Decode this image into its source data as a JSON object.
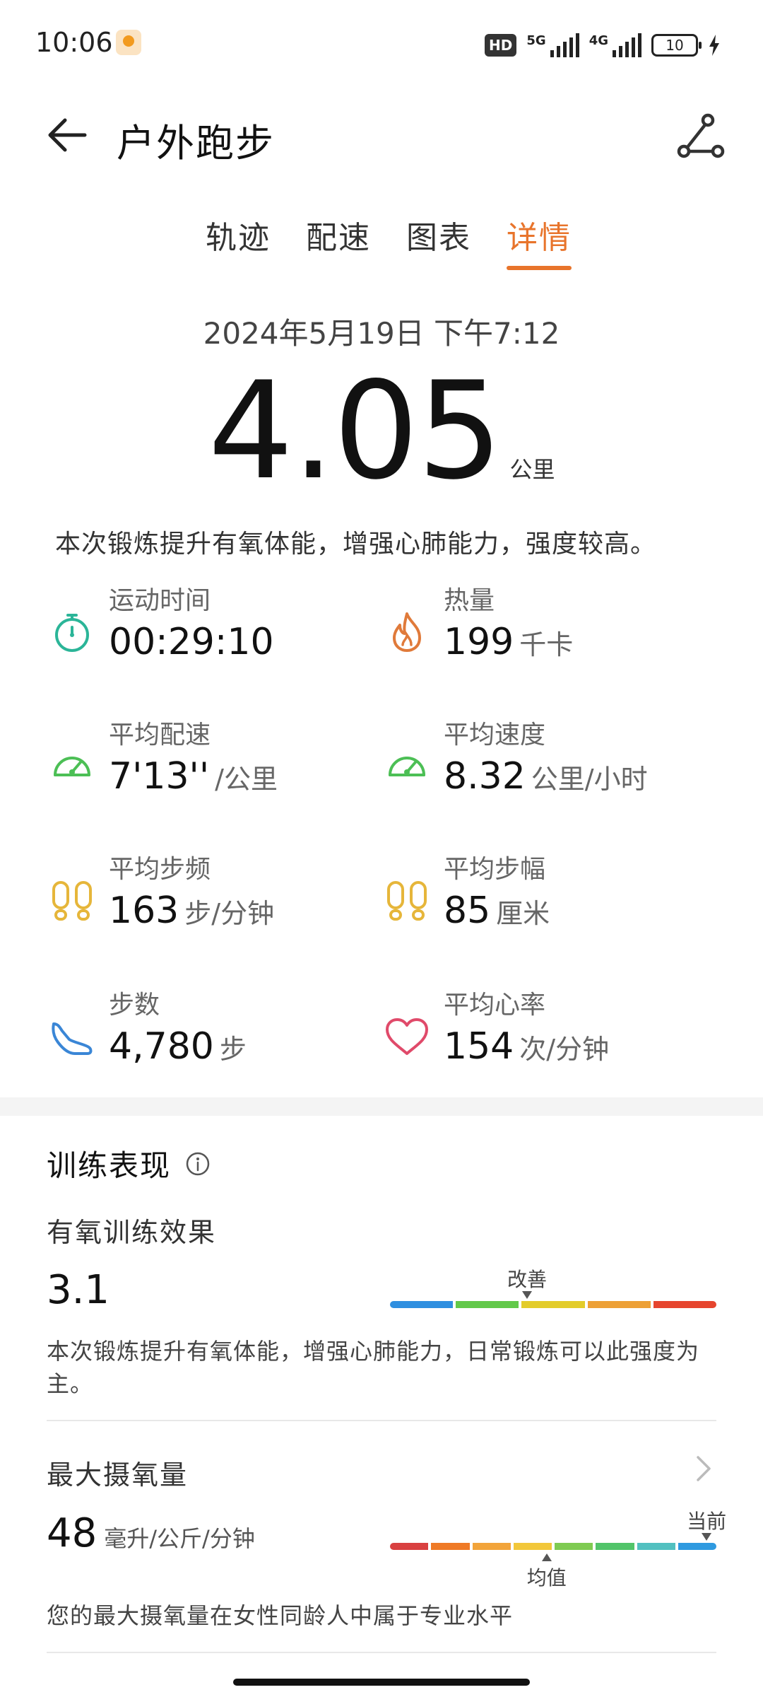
{
  "status_bar": {
    "time": "10:06",
    "hd_label": "HD",
    "net1": "5G",
    "net2": "4G",
    "battery": "10"
  },
  "header": {
    "title": "户外跑步",
    "back_icon": "arrow-left-icon",
    "share_icon": "route-share-icon"
  },
  "tabs": [
    {
      "label": "轨迹",
      "active": false
    },
    {
      "label": "配速",
      "active": false
    },
    {
      "label": "图表",
      "active": false
    },
    {
      "label": "详情",
      "active": true
    }
  ],
  "workout": {
    "date": "2024年5月19日 下午7:12",
    "distance": "4.05",
    "distance_unit": "公里",
    "summary": "本次锻炼提升有氧体能，增强心肺能力，强度较高。"
  },
  "metrics": [
    {
      "label": "运动时间",
      "value": "00:29:10",
      "unit": "",
      "icon": "stopwatch-icon",
      "color": "#2bb598"
    },
    {
      "label": "热量",
      "value": "199",
      "unit": "千卡",
      "icon": "flame-icon",
      "color": "#e07a3a"
    },
    {
      "label": "平均配速",
      "value": "7'13''",
      "unit": "/公里",
      "icon": "speedometer-icon",
      "color": "#4cbf55"
    },
    {
      "label": "平均速度",
      "value": "8.32",
      "unit": "公里/小时",
      "icon": "speedometer-icon",
      "color": "#4cbf55"
    },
    {
      "label": "平均步频",
      "value": "163",
      "unit": "步/分钟",
      "icon": "footprints-icon",
      "color": "#e6b63a"
    },
    {
      "label": "平均步幅",
      "value": "85",
      "unit": "厘米",
      "icon": "footprints-icon",
      "color": "#e6b63a"
    },
    {
      "label": "步数",
      "value": "4,780",
      "unit": "步",
      "icon": "shoe-icon",
      "color": "#3a86d6"
    },
    {
      "label": "平均心率",
      "value": "154",
      "unit": "次/分钟",
      "icon": "heart-icon",
      "color": "#e04a6a"
    }
  ],
  "training": {
    "section_title": "训练表现",
    "aerobic": {
      "title": "有氧训练效果",
      "value": "3.1",
      "marker_label": "改善",
      "marker_position": 0.42,
      "scale_colors": [
        "#2f8fe0",
        "#62c94a",
        "#e3cc2a",
        "#eda036",
        "#e6452e"
      ],
      "description": "本次锻炼提升有氧体能，增强心肺能力，日常锻炼可以此强度为主。"
    },
    "vo2max": {
      "title": "最大摄氧量",
      "value": "48",
      "unit": "毫升/公斤/分钟",
      "current_label": "当前",
      "current_position": 0.98,
      "average_label": "均值",
      "average_position": 0.48,
      "scale_colors": [
        "#d94040",
        "#ef7a26",
        "#f2a43a",
        "#f2c73a",
        "#7fcb52",
        "#52c46a",
        "#52c0c0",
        "#2f9ae0"
      ],
      "description": "您的最大摄氧量在女性同龄人中属于专业水平"
    }
  }
}
